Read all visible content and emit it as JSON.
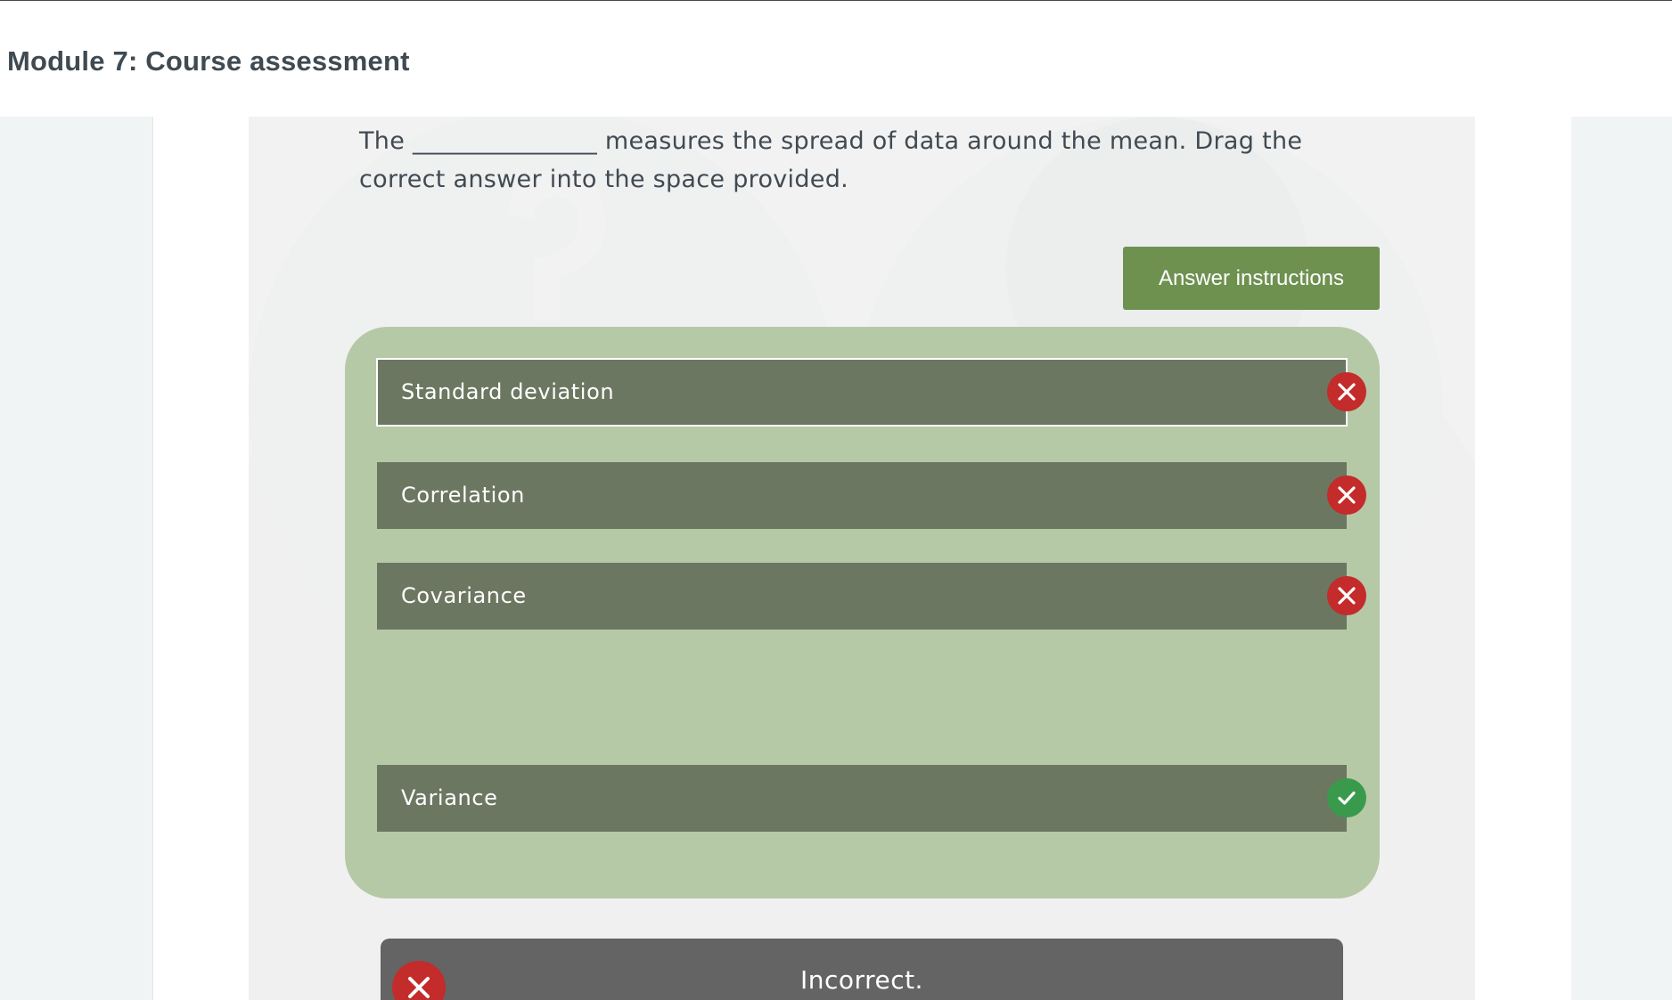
{
  "header": {
    "title": "Module 7: Course assessment"
  },
  "question": {
    "text": "The _______________ measures the spread of data around the mean. Drag the correct answer into the space provided."
  },
  "answer_instructions_label": "Answer instructions",
  "options": [
    {
      "label": "Standard deviation",
      "status": "incorrect",
      "icon": "close-icon"
    },
    {
      "label": "Correlation",
      "status": "incorrect",
      "icon": "close-icon"
    },
    {
      "label": "Covariance",
      "status": "incorrect",
      "icon": "close-icon"
    },
    {
      "label": "Variance",
      "status": "correct",
      "icon": "check-icon"
    }
  ],
  "feedback": {
    "text": "Incorrect.",
    "icon": "close-icon"
  },
  "colors": {
    "accent_green": "#6e9150",
    "drop_area": "#b6c9a7",
    "option_bg": "#6c7761",
    "incorrect_red": "#c42b2b",
    "correct_green": "#3a9a4c",
    "feedback_bg": "#646464"
  }
}
